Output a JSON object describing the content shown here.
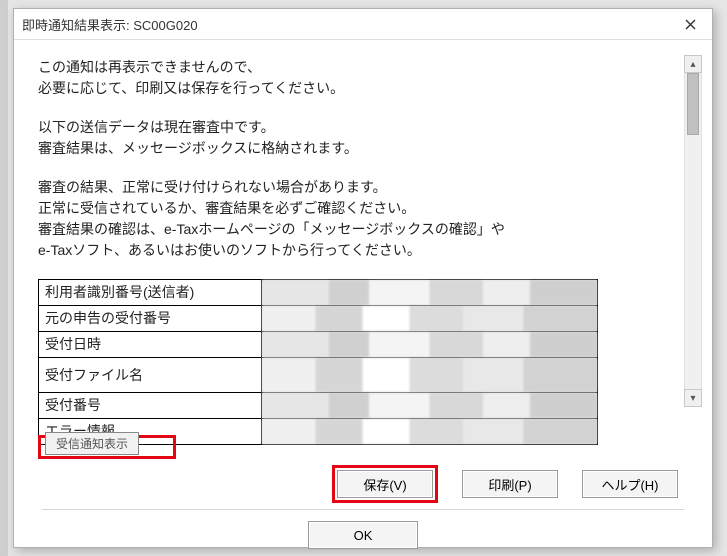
{
  "window": {
    "title": "即時通知結果表示: SC00G020"
  },
  "messages": {
    "p1": "この通知は再表示できませんので、\n必要に応じて、印刷又は保存を行ってください。",
    "p2": "以下の送信データは現在審査中です。\n審査結果は、メッセージボックスに格納されます。",
    "p3": "審査の結果、正常に受け付けられない場合があります。\n正常に受信されているか、審査結果を必ずご確認ください。\n審査結果の確認は、e-Taxホームページの「メッセージボックスの確認」や\ne-Taxソフト、あるいはお使いのソフトから行ってください。"
  },
  "table": {
    "rows": [
      {
        "label": "利用者識別番号(送信者)"
      },
      {
        "label": "元の申告の受付番号"
      },
      {
        "label": "受付日時"
      },
      {
        "label": "受付ファイル名"
      },
      {
        "label": "受付番号"
      },
      {
        "label": "エラー情報"
      }
    ]
  },
  "clipped_button_label": "受信通知表示",
  "buttons": {
    "save": "保存(V)",
    "print": "印刷(P)",
    "help": "ヘルプ(H)",
    "ok": "OK"
  }
}
